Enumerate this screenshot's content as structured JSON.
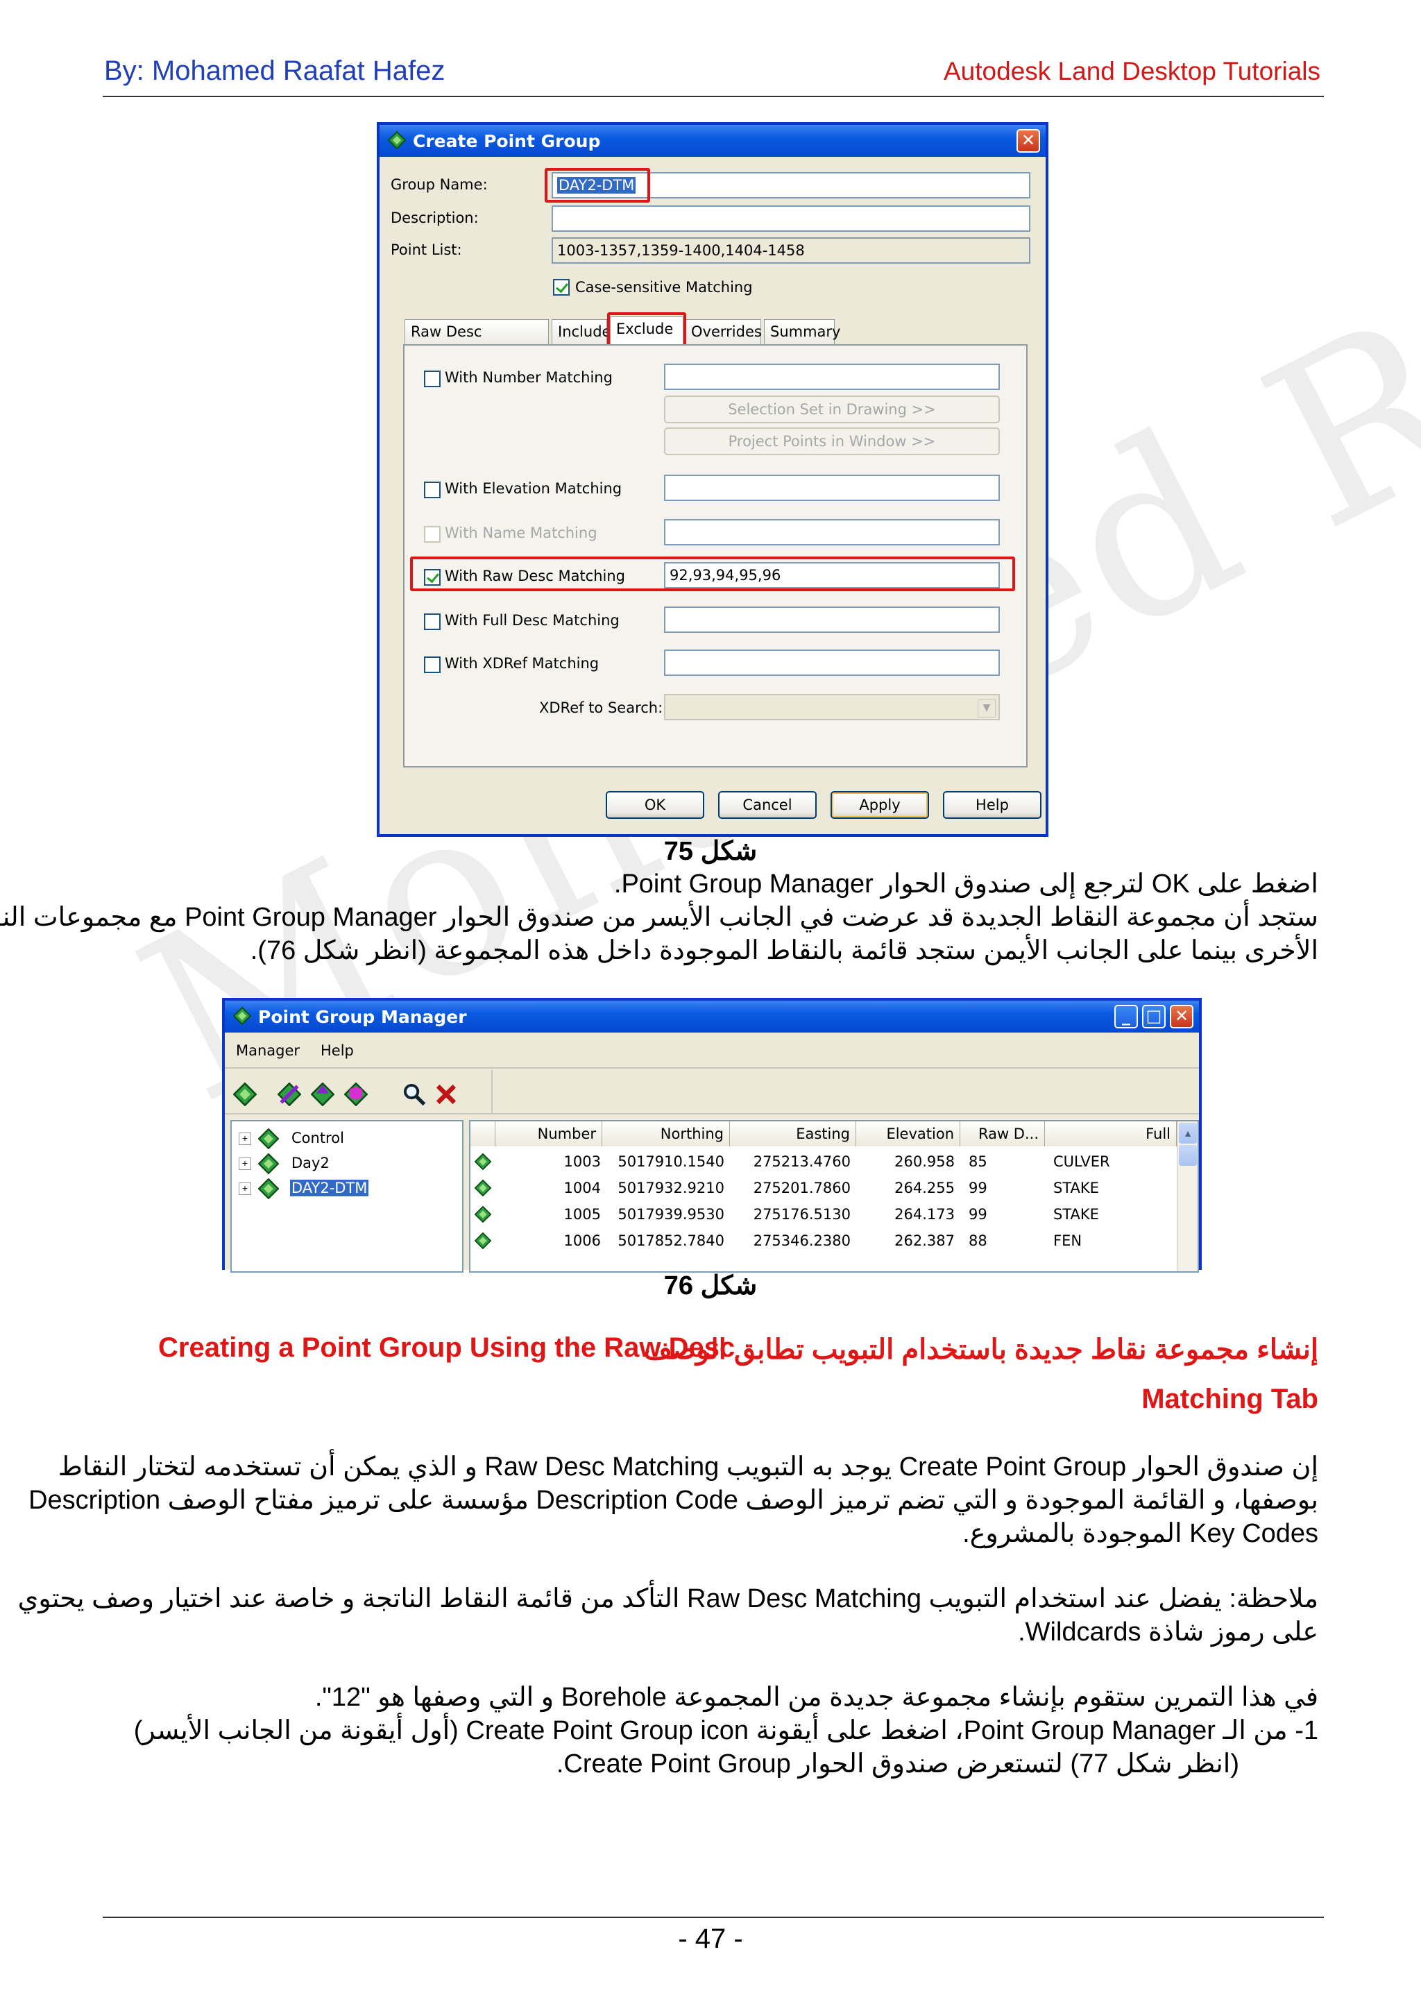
{
  "header": {
    "author": "By: Mohamed Raafat Hafez",
    "title": "Autodesk Land Desktop Tutorials"
  },
  "watermark": "Mohamed Raafat Hafez",
  "dialog1": {
    "title": "Create Point Group",
    "group_name_label": "Group Name:",
    "group_name_value": "DAY2-DTM",
    "description_label": "Description:",
    "description_value": "",
    "point_list_label": "Point List:",
    "point_list_value": "1003-1357,1359-1400,1404-1458",
    "case_sensitive_label": "Case-sensitive Matching",
    "tabs": [
      "Raw Desc Matching",
      "Include",
      "Exclude",
      "Overrides",
      "Summary"
    ],
    "active_tab": "Exclude",
    "number_matching_label": "With Number Matching",
    "selection_set_button": "Selection Set in Drawing >>",
    "project_points_button": "Project Points in Window >>",
    "elevation_matching_label": "With Elevation Matching",
    "name_matching_label": "With Name Matching",
    "raw_desc_matching_label": "With Raw Desc Matching",
    "raw_desc_matching_value": "92,93,94,95,96",
    "full_desc_matching_label": "With Full Desc Matching",
    "xdref_matching_label": "With XDRef Matching",
    "xdref_search_label": "XDRef to Search:",
    "buttons": {
      "ok": "OK",
      "cancel": "Cancel",
      "apply": "Apply",
      "help": "Help"
    }
  },
  "caption1": "شكل 75",
  "para1": {
    "line1": "اضغط على OK لترجع إلى صندوق الحوار Point Group Manager.",
    "line2": "ستجد أن مجموعة النقاط الجديدة قد عرضت في الجانب الأيسر من صندوق الحوار Point Group Manager مع مجموعات النقاط",
    "line3": "الأخرى بينما على الجانب الأيمن ستجد قائمة بالنقاط الموجودة داخل هذه المجموعة (انظر شكل 76)."
  },
  "dialog2": {
    "title": "Point Group Manager",
    "menu": [
      "Manager",
      "Help"
    ],
    "tree": [
      "Control",
      "Day2",
      "DAY2-DTM"
    ],
    "selected_group": "DAY2-DTM",
    "columns": [
      "Number",
      "Northing",
      "Easting",
      "Elevation",
      "Raw D...",
      "Full"
    ],
    "rows": [
      [
        "1003",
        "5017910.1540",
        "275213.4760",
        "260.958",
        "85",
        "CULVER"
      ],
      [
        "1004",
        "5017932.9210",
        "275201.7860",
        "264.255",
        "99",
        "STAKE"
      ],
      [
        "1005",
        "5017939.9530",
        "275176.5130",
        "264.173",
        "99",
        "STAKE"
      ],
      [
        "1006",
        "5017852.7840",
        "275346.2380",
        "262.387",
        "88",
        "FEN"
      ]
    ]
  },
  "caption2": "شكل 76",
  "section": {
    "title_en": "Creating a Point Group Using the Raw Desc",
    "title_ar": "إنشاء مجموعة نقاط جديدة باستخدام التبويب تطابق الوصف",
    "title_en2": "Matching Tab"
  },
  "para2": {
    "line1": "إن صندوق الحوار Create Point Group يوجد به التبويب Raw Desc Matching و الذي يمكن أن تستخدمه لتختار النقاط",
    "line2": "بوصفها، و القائمة الموجودة و التي تضم ترميز الوصف Description Code مؤسسة على ترميز مفتاح الوصف Description",
    "line3": "Key Codes الموجودة بالمشروع."
  },
  "note": {
    "line1": "ملاحظة: يفضل عند استخدام التبويب Raw Desc Matching التأكد من قائمة النقاط الناتجة و خاصة عند اختيار وصف يحتوي",
    "line2": "على رموز شاذة Wildcards."
  },
  "para3": {
    "line1": "في هذا التمرين ستقوم بإنشاء مجموعة جديدة من المجموعة Borehole و التي وصفها هو \"12\".",
    "line2": "1- من الـ Point Group Manager، اضغط على أيقونة Create Point Group icon (أول أيقونة من الجانب الأيسر)",
    "line3": "(انظر شكل 77) لتستعرض صندوق الحوار Create Point Group."
  },
  "footer": {
    "page": "- 47 -"
  },
  "colors": {
    "header_blue": "#1f3fb8",
    "accent_red": "#e01616",
    "xp_blue": "#0a36c8"
  }
}
